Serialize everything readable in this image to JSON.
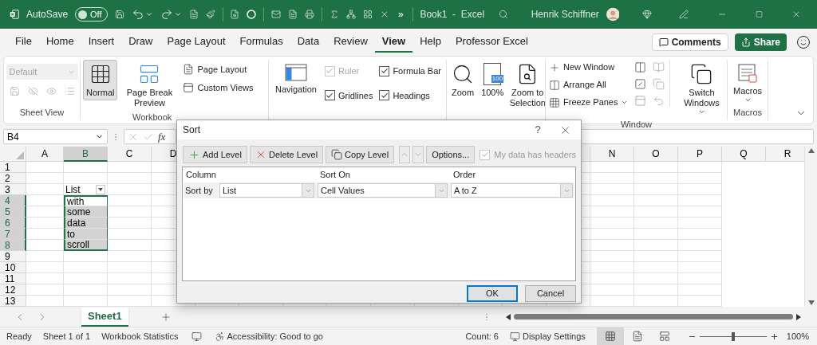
{
  "title_bar": {
    "autosave_label": "AutoSave",
    "autosave_toggle": {
      "label": "Off",
      "on": false
    },
    "quick_access_more": "»",
    "document_title": "Book1  -  Excel",
    "user_name": "Henrik Schiffner"
  },
  "menu_tabs": [
    {
      "label": "File",
      "selected": false
    },
    {
      "label": "Home",
      "selected": false
    },
    {
      "label": "Insert",
      "selected": false
    },
    {
      "label": "Draw",
      "selected": false
    },
    {
      "label": "Page Layout",
      "selected": false
    },
    {
      "label": "Formulas",
      "selected": false
    },
    {
      "label": "Data",
      "selected": false
    },
    {
      "label": "Review",
      "selected": false
    },
    {
      "label": "View",
      "selected": true
    },
    {
      "label": "Help",
      "selected": false
    },
    {
      "label": "Professor Excel",
      "selected": false
    }
  ],
  "comments_button": "Comments",
  "share_button": "Share",
  "ribbon": {
    "sheet_view": {
      "style_dropdown": {
        "value": "Default",
        "disabled": true
      },
      "label": "Sheet View"
    },
    "workbook_views": {
      "large_buttons": [
        {
          "label": "Normal",
          "selected": true
        },
        {
          "label": "Page Break Preview",
          "selected": false
        }
      ],
      "small_buttons": [
        "Page Layout",
        "Custom Views"
      ],
      "label": "Workbook"
    },
    "show": {
      "navigation": "Navigation",
      "checkboxes": [
        {
          "label": "Ruler",
          "checked": true,
          "disabled": true
        },
        {
          "label": "Formula Bar",
          "checked": true,
          "disabled": false
        },
        {
          "label": "Gridlines",
          "checked": true,
          "disabled": false
        },
        {
          "label": "Headings",
          "checked": true,
          "disabled": false
        }
      ]
    },
    "zoom": {
      "zoom_button": "Zoom",
      "hundred_button": "100%",
      "hundred_icon_text": "100",
      "selection_button": "Zoom to Selection"
    },
    "window": {
      "buttons": [
        "New Window",
        "Arrange All",
        "Freeze Panes"
      ],
      "switch_windows": "Switch Windows",
      "label": "Window"
    },
    "macros": {
      "button": "Macros",
      "label": "Macros"
    }
  },
  "formula_bar": {
    "name_box": "B4",
    "function_label": "fx"
  },
  "sheet": {
    "columns_left": [
      {
        "label": "A",
        "selected": false
      },
      {
        "label": "B",
        "selected": true
      },
      {
        "label": "C",
        "selected": false
      },
      {
        "label": "D",
        "selected": false
      }
    ],
    "columns_right": [
      {
        "label": "N",
        "selected": false
      },
      {
        "label": "O",
        "selected": false
      },
      {
        "label": "P",
        "selected": false
      },
      {
        "label": "Q",
        "selected": false
      },
      {
        "label": "R",
        "selected": false
      }
    ],
    "rows": [
      {
        "label": "1",
        "selected": false
      },
      {
        "label": "2",
        "selected": false
      },
      {
        "label": "3",
        "selected": false,
        "cell_b": {
          "text": "List",
          "selected": false,
          "active": false,
          "filter": true
        }
      },
      {
        "label": "4",
        "selected": true,
        "cell_b": {
          "text": "with",
          "selected": true,
          "active": true,
          "filter": false
        }
      },
      {
        "label": "5",
        "selected": true,
        "cell_b": {
          "text": "some",
          "selected": true,
          "active": false,
          "filter": false
        }
      },
      {
        "label": "6",
        "selected": true,
        "cell_b": {
          "text": "data",
          "selected": true,
          "active": false,
          "filter": false
        }
      },
      {
        "label": "7",
        "selected": true,
        "cell_b": {
          "text": "to",
          "selected": true,
          "active": false,
          "filter": false
        }
      },
      {
        "label": "8",
        "selected": true,
        "cell_b": {
          "text": "scroll",
          "selected": true,
          "active": false,
          "filter": false
        }
      },
      {
        "label": "9",
        "selected": false
      },
      {
        "label": "10",
        "selected": false
      },
      {
        "label": "11",
        "selected": false
      },
      {
        "label": "12",
        "selected": false
      },
      {
        "label": "13",
        "selected": false
      }
    ]
  },
  "sheet_tabs": [
    {
      "label": "Sheet1",
      "selected": true
    }
  ],
  "status_bar": {
    "items": [
      "Ready",
      "Sheet 1 of 1",
      "Workbook Statistics"
    ],
    "accessibility": "Accessibility: Good to go",
    "count": "Count: 6",
    "display_settings": "Display Settings",
    "views": [
      {
        "kind": "normal",
        "selected": true
      },
      {
        "kind": "page_layout",
        "selected": false
      },
      {
        "kind": "page_break",
        "selected": false
      }
    ],
    "zoom": {
      "level": 0.5,
      "reading": "100%"
    }
  },
  "dialog": {
    "title": "Sort",
    "help": "?",
    "toolbar": [
      {
        "kind": "add",
        "label": "Add Level",
        "disabled": false
      },
      {
        "kind": "delete",
        "label": "Delete Level",
        "disabled": false
      },
      {
        "kind": "copy",
        "label": "Copy Level",
        "disabled": false
      },
      {
        "kind": "up",
        "disabled": true
      },
      {
        "kind": "down",
        "disabled": true
      },
      {
        "kind": "options",
        "label": "Options...",
        "disabled": false
      }
    ],
    "headers_checkbox": {
      "label": "My data has headers",
      "checked": true,
      "disabled": true
    },
    "columns": [
      "Column",
      "Sort On",
      "Order"
    ],
    "levels": [
      {
        "label": "Sort by",
        "column": "List",
        "sort_on": "Cell Values",
        "order": "A to Z"
      }
    ],
    "buttons": [
      {
        "label": "OK",
        "default": true
      },
      {
        "label": "Cancel",
        "default": false
      }
    ]
  }
}
